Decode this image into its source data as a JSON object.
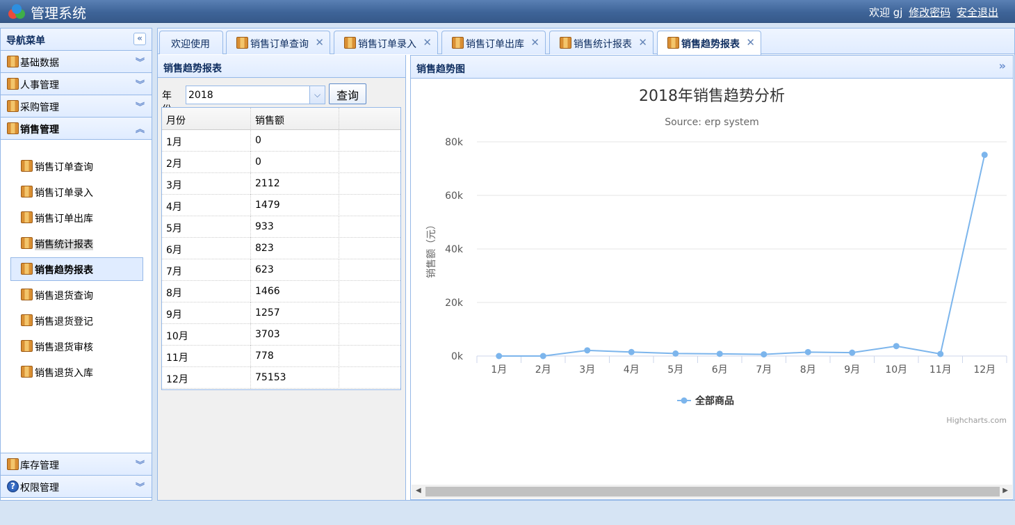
{
  "header": {
    "app_title": "管理系统",
    "welcome": "欢迎 gj",
    "change_password": "修改密码",
    "logout": "安全退出"
  },
  "nav": {
    "title": "导航菜单",
    "collapse_icon": "double-chevron-left-icon",
    "sections": [
      {
        "label": "基础数据",
        "expanded": false
      },
      {
        "label": "人事管理",
        "expanded": false
      },
      {
        "label": "采购管理",
        "expanded": false
      },
      {
        "label": "销售管理",
        "expanded": true
      },
      {
        "label": "库存管理",
        "expanded": false
      },
      {
        "label": "权限管理",
        "expanded": false
      }
    ],
    "sales_items": [
      {
        "label": "销售订单查询"
      },
      {
        "label": "销售订单录入"
      },
      {
        "label": "销售订单出库"
      },
      {
        "label": "销售统计报表"
      },
      {
        "label": "销售趋势报表"
      },
      {
        "label": "销售退货查询"
      },
      {
        "label": "销售退货登记"
      },
      {
        "label": "销售退货审核"
      },
      {
        "label": "销售退货入库"
      }
    ],
    "selected_item": "销售趋势报表",
    "hovered_item": "销售统计报表"
  },
  "tabs": [
    {
      "label": "欢迎使用",
      "closable": false
    },
    {
      "label": "销售订单查询",
      "closable": true
    },
    {
      "label": "销售订单录入",
      "closable": true
    },
    {
      "label": "销售订单出库",
      "closable": true
    },
    {
      "label": "销售统计报表",
      "closable": true
    },
    {
      "label": "销售趋势报表",
      "closable": true
    }
  ],
  "active_tab": "销售趋势报表",
  "report_panel": {
    "title": "销售趋势报表",
    "year_label": "年份:",
    "year_value": "2018",
    "query_button": "查询",
    "columns": [
      "月份",
      "销售额"
    ],
    "rows": [
      [
        "1月",
        "0"
      ],
      [
        "2月",
        "0"
      ],
      [
        "3月",
        "2112"
      ],
      [
        "4月",
        "1479"
      ],
      [
        "5月",
        "933"
      ],
      [
        "6月",
        "823"
      ],
      [
        "7月",
        "623"
      ],
      [
        "8月",
        "1466"
      ],
      [
        "9月",
        "1257"
      ],
      [
        "10月",
        "3703"
      ],
      [
        "11月",
        "778"
      ],
      [
        "12月",
        "75153"
      ]
    ]
  },
  "chart_panel": {
    "title": "销售趋势图",
    "expand_icon": "double-chevron-right-icon"
  },
  "chart_data": {
    "type": "line",
    "title": "2018年销售趋势分析",
    "subtitle": "Source: erp system",
    "ylabel": "销售额（元）",
    "xlabel": "",
    "categories": [
      "1月",
      "2月",
      "3月",
      "4月",
      "5月",
      "6月",
      "7月",
      "8月",
      "9月",
      "10月",
      "11月",
      "12月"
    ],
    "series": [
      {
        "name": "全部商品",
        "values": [
          0,
          0,
          2112,
          1479,
          933,
          823,
          623,
          1466,
          1257,
          3703,
          778,
          75153
        ]
      }
    ],
    "ylim": [
      0,
      80000
    ],
    "yticks": [
      0,
      20000,
      40000,
      60000,
      80000
    ],
    "ytick_labels": [
      "0k",
      "20k",
      "40k",
      "60k",
      "80k"
    ],
    "grid": true,
    "legend": "bottom-center",
    "credit": "Highcharts.com",
    "color": "#7cb5ec"
  },
  "colors": {
    "header": "#3e6498",
    "border": "#95b8e7",
    "panel_head": "#e0ecff",
    "series": "#7cb5ec"
  }
}
